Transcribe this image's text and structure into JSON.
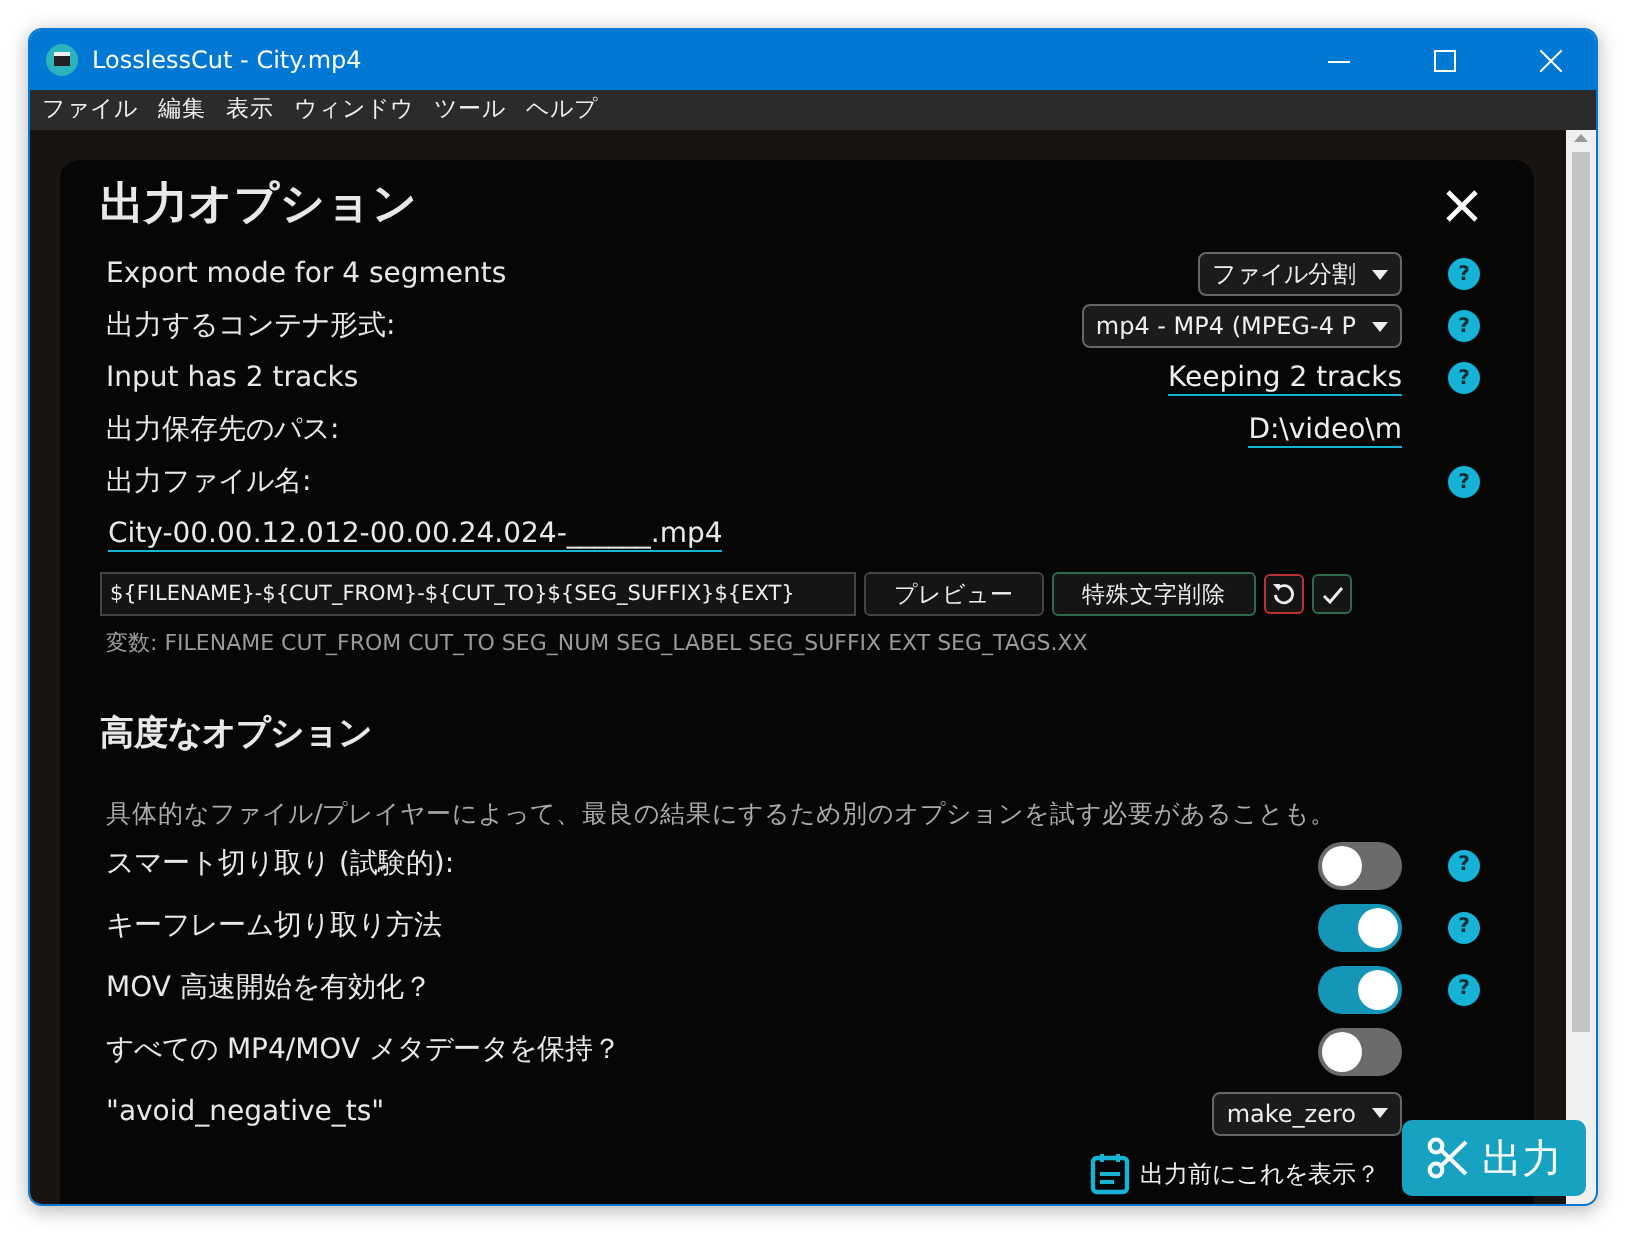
{
  "window": {
    "title": "LosslessCut - City.mp4"
  },
  "menu": [
    "ファイル",
    "編集",
    "表示",
    "ウィンドウ",
    "ツール",
    "ヘルプ"
  ],
  "dialog": {
    "title": "出力オプション",
    "rows": [
      {
        "kind": "select",
        "label": "Export mode for 4 segments",
        "value": "ファイル分割",
        "help": "?"
      },
      {
        "kind": "select",
        "label": "出力するコンテナ形式:",
        "value": "mp4 - MP4 (MPEG-4 P",
        "help": "?"
      },
      {
        "kind": "link",
        "label": "Input has 2 tracks",
        "value": "Keeping 2 tracks",
        "help": "?"
      },
      {
        "kind": "link",
        "label": "出力保存先のパス:",
        "value": "D:\\video\\m"
      }
    ],
    "filename": {
      "label": "出力ファイル名:",
      "help": "?",
      "preview": "City-00.00.12.012-00.00.24.024-______.mp4",
      "template": "${FILENAME}-${CUT_FROM}-${CUT_TO}${SEG_SUFFIX}${EXT}",
      "buttons": [
        "プレビュー",
        "特殊文字削除"
      ],
      "variables": "変数: FILENAME CUT_FROM CUT_TO SEG_NUM SEG_LABEL SEG_SUFFIX EXT SEG_TAGS.XX"
    },
    "advanced": {
      "title": "高度なオプション",
      "note": "具体的なファイル/プレイヤーによって、最良の結果にするため別のオプションを試す必要があることも。",
      "rows": [
        {
          "kind": "toggle",
          "label": "スマート切り取り (試験的):",
          "on": false,
          "help": "?"
        },
        {
          "kind": "toggle",
          "label": "キーフレーム切り取り方法",
          "on": true,
          "help": "?"
        },
        {
          "kind": "toggle",
          "label": "MOV 高速開始を有効化？",
          "on": true,
          "help": "?"
        },
        {
          "kind": "toggle",
          "label": "すべての MP4/MOV メタデータを保持？",
          "on": false
        },
        {
          "kind": "select",
          "label": "\"avoid_negative_ts\"",
          "value": "make_zero"
        }
      ]
    }
  },
  "export_bar": {
    "confirm_label": "出力前にこれを表示？",
    "button": "出力"
  }
}
